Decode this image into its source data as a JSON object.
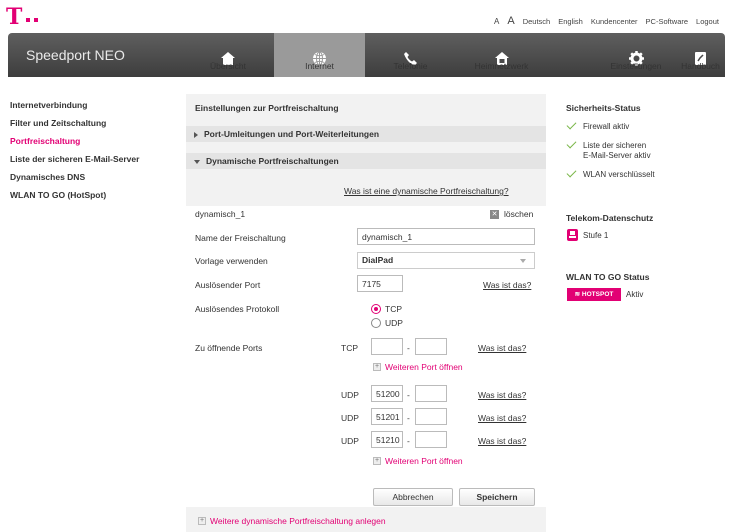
{
  "topbar": {
    "logo_mark": "T",
    "font_small": "A",
    "font_large": "A",
    "lang_de": "Deutsch",
    "lang_en": "English",
    "kundencenter": "Kundencenter",
    "pc_software": "PC-Software",
    "logout": "Logout"
  },
  "header": {
    "brand": "Speedport NEO",
    "nav": [
      {
        "label": "Übersicht",
        "icon": "home-icon"
      },
      {
        "label": "Internet",
        "icon": "globe-icon"
      },
      {
        "label": "Telefonie",
        "icon": "phone-icon"
      },
      {
        "label": "Heimnetzwerk",
        "icon": "home-network-icon"
      },
      {
        "label": "Einstellungen",
        "icon": "gear-icon"
      },
      {
        "label": "Handbuch",
        "icon": "manual-icon"
      }
    ],
    "active": "Internet"
  },
  "sidebar": {
    "items": [
      {
        "label": "Internetverbindung"
      },
      {
        "label": "Filter und Zeitschaltung"
      },
      {
        "label": "Portfreischaltung"
      },
      {
        "label": "Liste der sicheren E-Mail-Server"
      },
      {
        "label": "Dynamisches DNS"
      },
      {
        "label": "WLAN TO GO (HotSpot)"
      }
    ],
    "active": "Portfreischaltung"
  },
  "main": {
    "title": "Einstellungen zur Portfreischaltung",
    "section_port_forwarding": "Port-Umleitungen und Port-Weiterleitungen",
    "section_dynamic": "Dynamische Portfreischaltungen",
    "what_is_dynamic_link": "Was ist eine dynamische Portfreischaltung?",
    "entry_name": "dynamisch_1",
    "delete_label": "löschen",
    "name_label": "Name der Freischaltung",
    "name_value": "dynamisch_1",
    "template_label": "Vorlage verwenden",
    "template_value": "DialPad",
    "trigger_port_label": "Auslösender Port",
    "trigger_port_value": "7175",
    "what_is_link": "Was ist das?",
    "trigger_protocol_label": "Auslösendes Protokoll",
    "protocol_tcp": "TCP",
    "protocol_udp": "UDP",
    "protocol_selected": "TCP",
    "ports_label": "Zu öffnende Ports",
    "tcp_label": "TCP",
    "udp_label": "UDP",
    "dash": "-",
    "tcp_from": "",
    "tcp_to": "",
    "udp_rows": [
      {
        "from": "51200",
        "to": ""
      },
      {
        "from": "51201",
        "to": ""
      },
      {
        "from": "51210",
        "to": ""
      }
    ],
    "add_port_link": "Weiteren Port öffnen",
    "cancel_label": "Abbrechen",
    "save_label": "Speichern",
    "add_dynamic_link": "Weitere dynamische Portfreischaltung anlegen"
  },
  "right": {
    "security_title": "Sicherheits-Status",
    "firewall": "Firewall aktiv",
    "mail_line1": "Liste der sicheren",
    "mail_line2": "E-Mail-Server aktiv",
    "wlan": "WLAN verschlüsselt",
    "privacy_title": "Telekom-Datenschutz",
    "privacy_level": "Stufe 1",
    "wlantogo_title": "WLAN TO GO Status",
    "hotspot_badge": "HOTSPOT",
    "hotspot_status": "Aktiv"
  },
  "colors": {
    "accent": "#e20074",
    "check": "#7ab648",
    "header": "#4a4a4a"
  }
}
